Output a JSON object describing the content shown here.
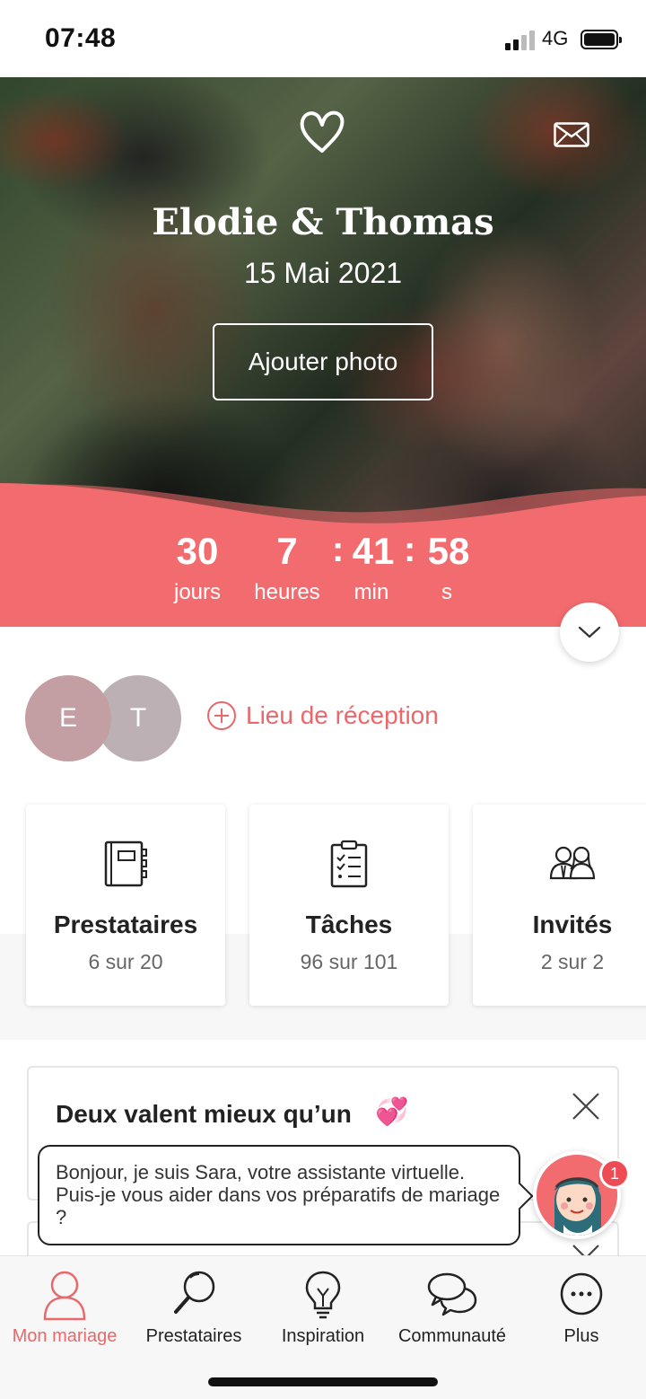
{
  "status_bar": {
    "time": "07:48",
    "network": "4G"
  },
  "hero": {
    "couple_names": "Elodie & Thomas",
    "date": "15 Mai 2021",
    "add_photo_label": "Ajouter photo"
  },
  "countdown": {
    "days": "30",
    "days_label": "jours",
    "hours": "7",
    "hours_label": "heures",
    "minutes": "41",
    "minutes_label": "min",
    "seconds": "58",
    "seconds_label": "s",
    "separator": ":"
  },
  "couple": {
    "initial_1": "E",
    "initial_2": "T",
    "venue_link": "Lieu de réception"
  },
  "cards": [
    {
      "title": "Prestataires",
      "subtitle": "6 sur 20",
      "icon": "notebook-icon"
    },
    {
      "title": "Tâches",
      "subtitle": "96 sur 101",
      "icon": "checklist-icon"
    },
    {
      "title": "Invités",
      "subtitle": "2 sur 2",
      "icon": "guests-icon"
    }
  ],
  "promo": {
    "title": "Deux valent mieux qu’un",
    "emoji": "💞"
  },
  "assistant": {
    "message": "Bonjour, je suis Sara, votre assistante virtuelle. Puis-je vous aider dans vos préparatifs de mariage ?",
    "badge": "1"
  },
  "bottom_nav": {
    "items": [
      {
        "label": "Mon mariage",
        "icon": "person-icon",
        "active": true
      },
      {
        "label": "Prestataires",
        "icon": "magnifier-icon",
        "active": false
      },
      {
        "label": "Inspiration",
        "icon": "lightbulb-icon",
        "active": false
      },
      {
        "label": "Communauté",
        "icon": "chat-bubbles-icon",
        "active": false
      },
      {
        "label": "Plus",
        "icon": "more-icon",
        "active": false
      }
    ]
  },
  "colors": {
    "accent": "#f26b6e",
    "accent_text": "#e8686b",
    "avatar_e": "#c39ea3",
    "avatar_t": "#bdb0b5"
  }
}
